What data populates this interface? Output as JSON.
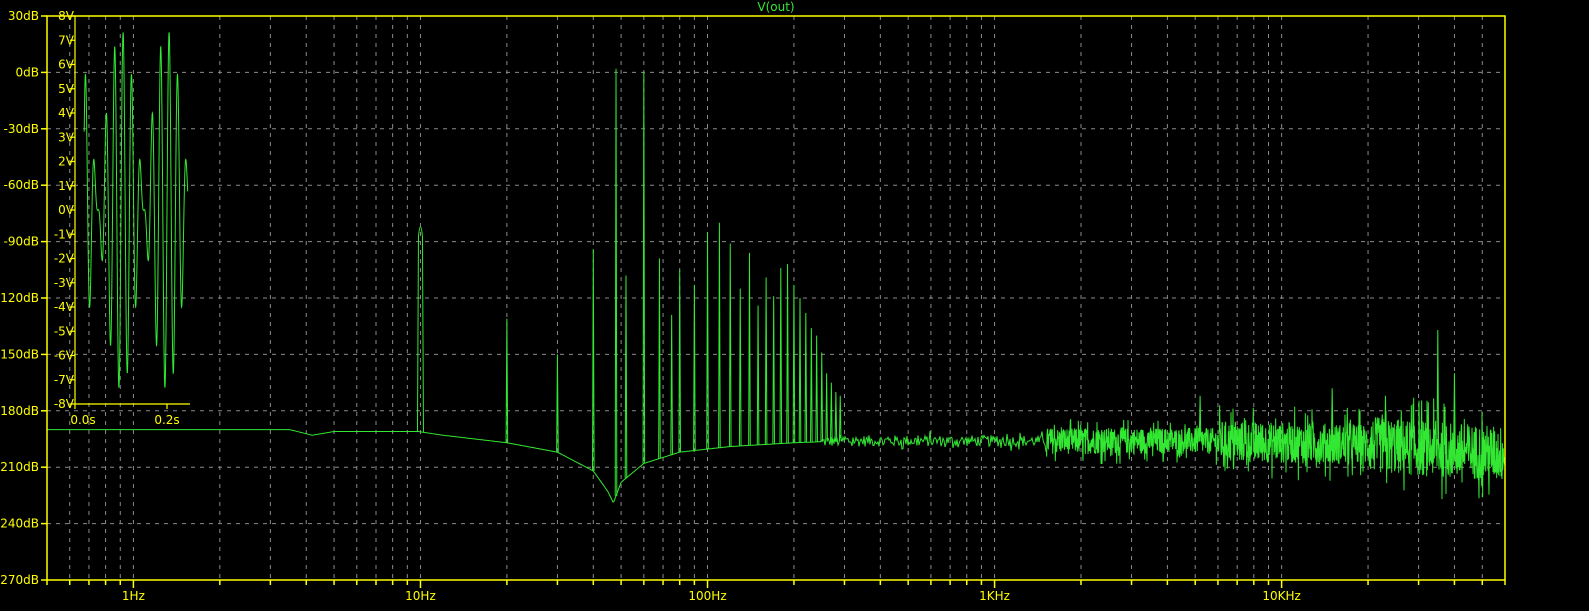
{
  "chart_data": [
    {
      "type": "line",
      "title": "V(out)",
      "x_scale": "log",
      "xlim": [
        0.5,
        60000
      ],
      "ylim": [
        -270,
        30
      ],
      "y_unit": "dB",
      "x_ticks": [
        {
          "value": 1,
          "label": "1Hz"
        },
        {
          "value": 10,
          "label": "10Hz"
        },
        {
          "value": 100,
          "label": "100Hz"
        },
        {
          "value": 1000,
          "label": "1KHz"
        },
        {
          "value": 10000,
          "label": "10KHz"
        }
      ],
      "y_ticks": [
        {
          "value": 30,
          "label": "30dB"
        },
        {
          "value": 0,
          "label": "0dB"
        },
        {
          "value": -30,
          "label": "-30dB"
        },
        {
          "value": -60,
          "label": "-60dB"
        },
        {
          "value": -90,
          "label": "-90dB"
        },
        {
          "value": -120,
          "label": "-120dB"
        },
        {
          "value": -150,
          "label": "-150dB"
        },
        {
          "value": -180,
          "label": "-180dB"
        },
        {
          "value": -210,
          "label": "-210dB"
        },
        {
          "value": -240,
          "label": "-240dB"
        },
        {
          "value": -270,
          "label": "-270dB"
        }
      ],
      "grid": true,
      "noise_floor": [
        {
          "x": 0.5,
          "y": -190
        },
        {
          "x": 3.5,
          "y": -190
        },
        {
          "x": 4.2,
          "y": -193
        },
        {
          "x": 5,
          "y": -191
        },
        {
          "x": 9.8,
          "y": -191
        },
        {
          "x": 12,
          "y": -193
        },
        {
          "x": 20,
          "y": -197
        },
        {
          "x": 30,
          "y": -202
        },
        {
          "x": 40,
          "y": -212
        },
        {
          "x": 45,
          "y": -223
        },
        {
          "x": 47,
          "y": -229
        },
        {
          "x": 50,
          "y": -218
        },
        {
          "x": 60,
          "y": -208
        },
        {
          "x": 80,
          "y": -202
        },
        {
          "x": 120,
          "y": -199
        },
        {
          "x": 200,
          "y": -197
        },
        {
          "x": 300,
          "y": -196
        },
        {
          "x": 1000,
          "y": -196
        },
        {
          "x": 5000,
          "y": -196
        },
        {
          "x": 20000,
          "y": -198
        },
        {
          "x": 60000,
          "y": -203
        }
      ],
      "peaks": [
        {
          "x": 10,
          "y": -80
        },
        {
          "x": 20,
          "y": -131
        },
        {
          "x": 30,
          "y": -150
        },
        {
          "x": 40,
          "y": -94
        },
        {
          "x": 48,
          "y": 2
        },
        {
          "x": 52,
          "y": -108
        },
        {
          "x": 60,
          "y": 0
        },
        {
          "x": 68,
          "y": -99
        },
        {
          "x": 75,
          "y": -129
        },
        {
          "x": 80,
          "y": -105
        },
        {
          "x": 90,
          "y": -113
        },
        {
          "x": 100,
          "y": -85
        },
        {
          "x": 110,
          "y": -80
        },
        {
          "x": 120,
          "y": -91
        },
        {
          "x": 130,
          "y": -115
        },
        {
          "x": 140,
          "y": -96
        },
        {
          "x": 150,
          "y": -124
        },
        {
          "x": 160,
          "y": -109
        },
        {
          "x": 170,
          "y": -119
        },
        {
          "x": 180,
          "y": -104
        },
        {
          "x": 190,
          "y": -102
        },
        {
          "x": 200,
          "y": -113
        },
        {
          "x": 210,
          "y": -120
        },
        {
          "x": 220,
          "y": -128
        },
        {
          "x": 230,
          "y": -136
        },
        {
          "x": 240,
          "y": -140
        },
        {
          "x": 250,
          "y": -149
        },
        {
          "x": 260,
          "y": -160
        },
        {
          "x": 270,
          "y": -165
        },
        {
          "x": 280,
          "y": -170
        },
        {
          "x": 290,
          "y": -172
        },
        {
          "x": 5200,
          "y": -172
        },
        {
          "x": 15000,
          "y": -168
        },
        {
          "x": 23000,
          "y": -172
        },
        {
          "x": 35000,
          "y": -137
        },
        {
          "x": 40000,
          "y": -160
        }
      ]
    },
    {
      "type": "line",
      "title": "",
      "xlim": [
        0.0,
        0.25
      ],
      "ylim": [
        -8,
        8
      ],
      "y_unit": "V",
      "x_ticks": [
        {
          "value": 0.0,
          "label": "0.0s"
        },
        {
          "value": 0.2,
          "label": "0.2s"
        }
      ],
      "y_ticks": [
        {
          "value": 8,
          "label": "8V"
        },
        {
          "value": 7,
          "label": "7V"
        },
        {
          "value": 6,
          "label": "6V"
        },
        {
          "value": 5,
          "label": "5V"
        },
        {
          "value": 4,
          "label": "4V"
        },
        {
          "value": 3,
          "label": "3V"
        },
        {
          "value": 2,
          "label": "2V"
        },
        {
          "value": 1,
          "label": "1V"
        },
        {
          "value": 0,
          "label": "0V"
        },
        {
          "value": -1,
          "label": "-1V"
        },
        {
          "value": -2,
          "label": "-2V"
        },
        {
          "value": -3,
          "label": "-3V"
        },
        {
          "value": -4,
          "label": "-4V"
        },
        {
          "value": -5,
          "label": "-5V"
        },
        {
          "value": -6,
          "label": "-6V"
        },
        {
          "value": -7,
          "label": "-7V"
        },
        {
          "value": -8,
          "label": "-8V"
        }
      ],
      "signal": {
        "duration": 0.25,
        "components": [
          {
            "freq": 50,
            "amp": 4
          },
          {
            "freq": 60,
            "amp": 3.4
          }
        ]
      }
    }
  ],
  "colors": {
    "background": "#000000",
    "frame": "#ffff00",
    "grid": "#8a8a8a",
    "trace": "#33e833",
    "axis_text": "#ffff00",
    "title_text": "#33e833"
  }
}
